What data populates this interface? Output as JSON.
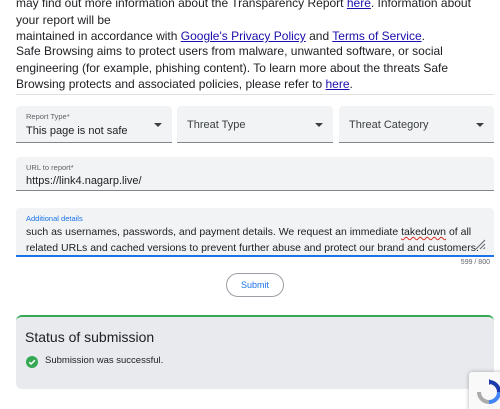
{
  "intro": {
    "line1_pre": "may find out more information about the Transparency Report ",
    "line1_link1": "here",
    "line1_post": ". Information about your report will be",
    "line2_pre": "maintained in accordance with ",
    "line2_link1": "Google's Privacy Policy",
    "line2_mid": " and ",
    "line2_link2": "Terms of Service",
    "line2_post": "."
  },
  "about": {
    "text_pre": "Safe Browsing aims to protect users from malware, unwanted software, or social engineering (for example, phishing content). To learn more about the threats Safe Browsing protects and associated policies, please refer to ",
    "link": "here",
    "text_post": "."
  },
  "form": {
    "report_type": {
      "label": "Report Type*",
      "value": "This page is not safe"
    },
    "threat_type": {
      "placeholder": "Threat Type"
    },
    "threat_category": {
      "placeholder": "Threat Category"
    },
    "url": {
      "label": "URL to report*",
      "value": "https://link4.nagarp.live/"
    },
    "details": {
      "label": "Additional details",
      "text_pre": "such as usernames, passwords, and payment details. We request an immediate ",
      "text_misspelled": "takedown",
      "text_post": " of all related URLs and cached versions to prevent further abuse and protect our brand and customers."
    },
    "char_count": "599 / 800",
    "submit_label": "Submit"
  },
  "status": {
    "title": "Status of submission",
    "message": "Submission was successful."
  },
  "colors": {
    "link": "#1a0dab",
    "accent": "#1a73e8",
    "success": "#34a853",
    "field_bg": "#f1f3f4",
    "card_bg": "#e8eaed"
  },
  "icons": {
    "dropdown": "caret-down-icon",
    "status": "check-circle-icon",
    "resize": "resize-handle-icon",
    "badge": "recaptcha-icon"
  }
}
